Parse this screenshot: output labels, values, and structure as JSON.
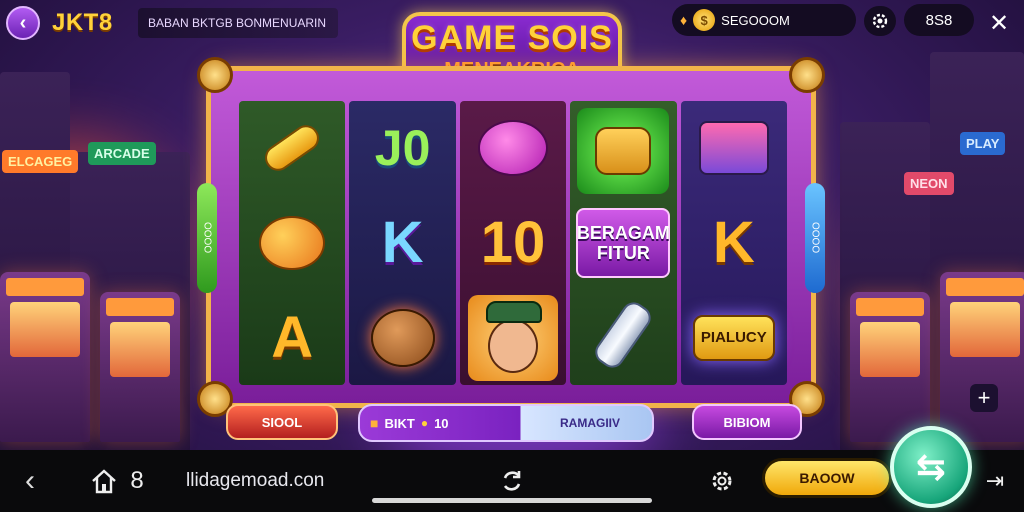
{
  "header": {
    "back_icon": "chevron-left-icon",
    "brand": "JKT8",
    "banner_text": "BABAN BKTGB BONMENUARIN",
    "coin_value": "SEGOOOM",
    "coin_icon": "coin-icon",
    "settings_icon": "gear-icon",
    "balance": "8S8",
    "close_icon": "close-icon"
  },
  "game": {
    "title_line1": "GAME SOIS",
    "title_line2": "MENEAKRICA",
    "side_left_label": "OOOO",
    "side_right_label": "OOOO",
    "reels": [
      [
        "banana",
        "mango",
        "A"
      ],
      [
        "J0",
        "K",
        "cat-face"
      ],
      [
        "pink-creature",
        "10",
        "man-with-hat"
      ],
      [
        "gold-face",
        "BERAGAM FITUR",
        "potion-bottle"
      ],
      [
        "jukebox",
        "K",
        "PIALUCY"
      ]
    ]
  },
  "controls": {
    "left_button": "SIOOL",
    "mid_left_label": "BIKT",
    "mid_value": "10",
    "mid_right_label": "RAMAGIIV",
    "right_button": "BIBIOM",
    "plus_label": "+"
  },
  "bottom_bar": {
    "back_icon": "chevron-left-icon",
    "home_icon": "home-icon",
    "tab_count": "8",
    "url": "llidagemoad.con",
    "reload_icon": "refresh-icon",
    "gear_icon": "gear-icon",
    "balance_button": "BAOOW",
    "spin_icon": "spin-arrow-icon",
    "exit_icon": "exit-icon"
  },
  "colors": {
    "accent_gold": "#ffd23a",
    "frame_purple": "#7a1e9a",
    "spin_green": "#17a57a"
  }
}
